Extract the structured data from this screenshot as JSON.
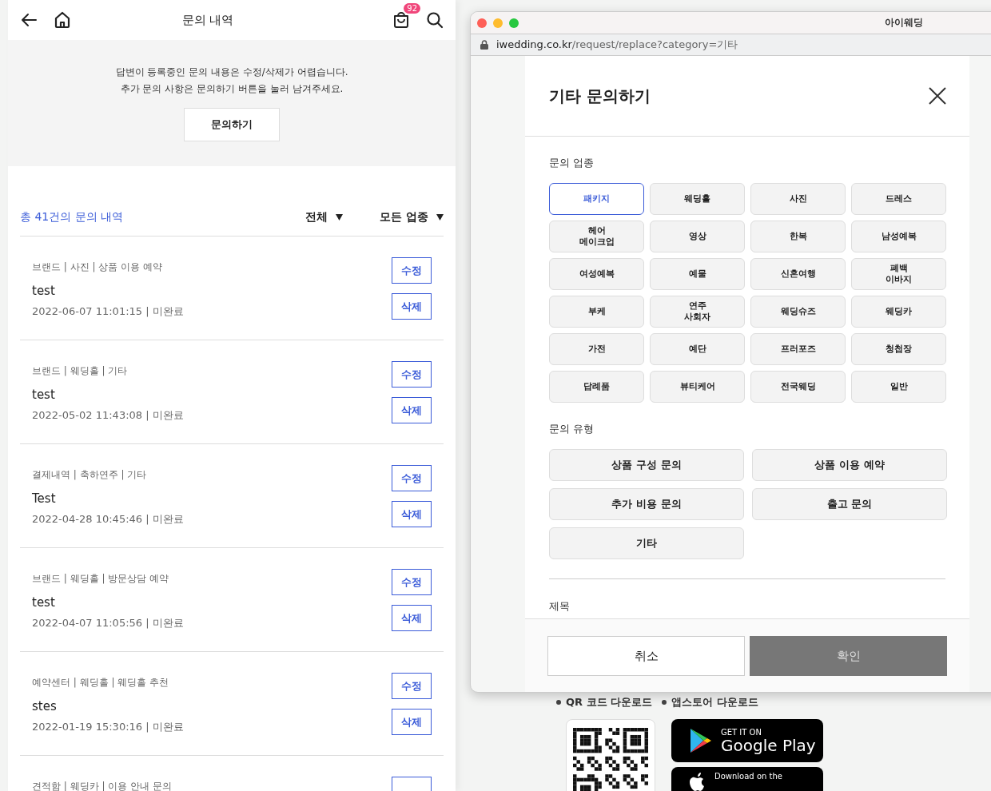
{
  "header": {
    "title": "문의 내역",
    "cart_badge": "92"
  },
  "notice": {
    "lines": [
      "답변이 등록중인 문의 내용은 수정/삭제가 어렵습니다.",
      "추가 문의 사항은 문의하기 버튼을 눌러 남겨주세요."
    ],
    "button": "문의하기"
  },
  "summary": {
    "total": "총 41건의 문의 내역",
    "filters": [
      "전체",
      "모든 업종"
    ]
  },
  "inquiries": [
    {
      "meta": "브랜드 | 사진 | 상품 이용 예약",
      "title": "test",
      "date": "2022-06-07 11:01:15 | 미완료",
      "edit": "수정",
      "delete": "삭제"
    },
    {
      "meta": "브랜드 | 웨딩홀 | 기타",
      "title": "test",
      "date": "2022-05-02 11:43:08 | 미완료",
      "edit": "수정",
      "delete": "삭제"
    },
    {
      "meta": "결제내역 | 축하연주 | 기타",
      "title": "Test",
      "date": "2022-04-28 10:45:46 | 미완료",
      "edit": "수정",
      "delete": "삭제"
    },
    {
      "meta": "브랜드 | 웨딩홀 | 방문상담 예약",
      "title": "test",
      "date": "2022-04-07 11:05:56 | 미완료",
      "edit": "수정",
      "delete": "삭제"
    },
    {
      "meta": "예약센터 | 웨딩홀 | 웨딩홀 추천",
      "title": "stes",
      "date": "2022-01-19 15:30:16 | 미완료",
      "edit": "수정",
      "delete": "삭제"
    },
    {
      "meta": "견적함 | 웨딩카 | 이용 안내 문의"
    }
  ],
  "browser": {
    "title": "아이웨딩",
    "url_host": "iwedding.co.kr",
    "url_path": "/request/replace?category=기타"
  },
  "modal": {
    "title": "기타 문의하기",
    "category_label": "문의 업종",
    "categories": [
      {
        "label": "패키지",
        "selected": true
      },
      {
        "label": "웨딩홀",
        "selected": false
      },
      {
        "label": "사진",
        "selected": false
      },
      {
        "label": "드레스",
        "selected": false
      },
      {
        "label": "헤어\n메이크업",
        "selected": false
      },
      {
        "label": "영상",
        "selected": false
      },
      {
        "label": "한복",
        "selected": false
      },
      {
        "label": "남성예복",
        "selected": false
      },
      {
        "label": "여성예복",
        "selected": false
      },
      {
        "label": "예물",
        "selected": false
      },
      {
        "label": "신혼여행",
        "selected": false
      },
      {
        "label": "폐백\n이바지",
        "selected": false
      },
      {
        "label": "부케",
        "selected": false
      },
      {
        "label": "연주\n사회자",
        "selected": false
      },
      {
        "label": "웨딩슈즈",
        "selected": false
      },
      {
        "label": "웨딩카",
        "selected": false
      },
      {
        "label": "가전",
        "selected": false
      },
      {
        "label": "예단",
        "selected": false
      },
      {
        "label": "프러포즈",
        "selected": false
      },
      {
        "label": "청첩장",
        "selected": false
      },
      {
        "label": "답례품",
        "selected": false
      },
      {
        "label": "뷰티케어",
        "selected": false
      },
      {
        "label": "전국웨딩",
        "selected": false
      },
      {
        "label": "일반",
        "selected": false
      }
    ],
    "type_label": "문의 유형",
    "types": [
      {
        "label": "상품 구성 문의",
        "selected": false
      },
      {
        "label": "상품 이용 예약",
        "selected": false
      },
      {
        "label": "추가 비용 문의",
        "selected": false
      },
      {
        "label": "출고 문의",
        "selected": false
      },
      {
        "label": "기타",
        "selected": false
      }
    ],
    "subject_label": "제목",
    "cancel": "취소",
    "confirm": "확인",
    "confirm_disabled": true
  },
  "footer": {
    "qr_label": "QR 코드 다운로드",
    "store_label": "앱스토어 다운로드",
    "google_small": "GET IT ON",
    "google_big": "Google Play",
    "apple_small": "Download on the"
  }
}
